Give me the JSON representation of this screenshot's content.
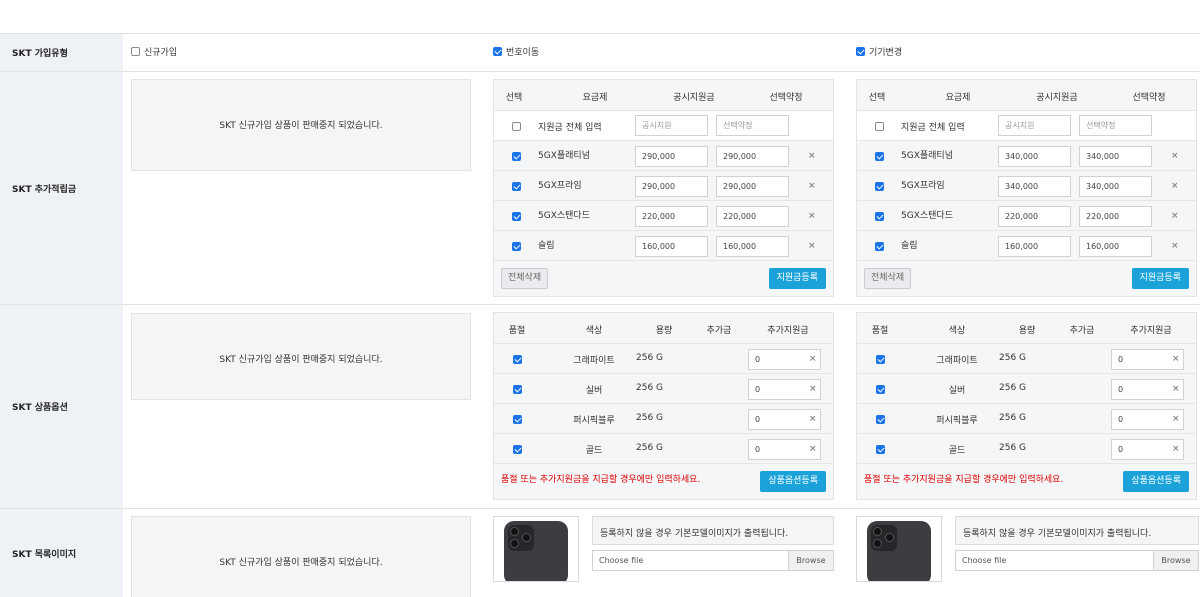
{
  "rows": {
    "type_label": "SKT 가입유형",
    "support_label": "SKT 추가적립금",
    "option_label": "SKT 상품옵션",
    "image_label": "SKT 목록이미지"
  },
  "join_types": [
    {
      "label": "신규가입",
      "checked": false
    },
    {
      "label": "번호이동",
      "checked": true
    },
    {
      "label": "기기변경",
      "checked": true
    }
  ],
  "notice_text": "SKT 신규가입 상품이 판매중지 되었습니다.",
  "support_headers": [
    "선택",
    "요금제",
    "공시지원금",
    "선택약정"
  ],
  "bulk": {
    "label": "지원금 전체 입력",
    "ph1": "공시지원",
    "ph2": "선택약정"
  },
  "support_panels": [
    {
      "plans": [
        {
          "name": "5GX플래티넘",
          "v1": "290,000",
          "v2": "290,000"
        },
        {
          "name": "5GX프라임",
          "v1": "290,000",
          "v2": "290,000"
        },
        {
          "name": "5GX스탠다드",
          "v1": "220,000",
          "v2": "220,000"
        },
        {
          "name": "슬림",
          "v1": "160,000",
          "v2": "160,000"
        }
      ]
    },
    {
      "plans": [
        {
          "name": "5GX플래티넘",
          "v1": "340,000",
          "v2": "340,000"
        },
        {
          "name": "5GX프라임",
          "v1": "340,000",
          "v2": "340,000"
        },
        {
          "name": "5GX스탠다드",
          "v1": "220,000",
          "v2": "220,000"
        },
        {
          "name": "슬림",
          "v1": "160,000",
          "v2": "160,000"
        }
      ]
    }
  ],
  "buttons": {
    "delete_all": "전체삭제",
    "register_support": "지원금등록",
    "register_option": "상품옵션등록",
    "browse": "Browse",
    "choose_file": "Choose file"
  },
  "option_headers": [
    "품절",
    "색상",
    "용량",
    "추가금",
    "추가지원금"
  ],
  "options": [
    {
      "color": "그래파이트",
      "capacity": "256 G",
      "extra": "0"
    },
    {
      "color": "실버",
      "capacity": "256 G",
      "extra": "0"
    },
    {
      "color": "퍼시픽블루",
      "capacity": "256 G",
      "extra": "0"
    },
    {
      "color": "골드",
      "capacity": "256 G",
      "extra": "0"
    }
  ],
  "option_warning": "품절 또는 추가지원금을 지급할 경우에만 입력하세요.",
  "image_note": "등록하지 않을 경우 기본모델이미지가 출력됩니다.",
  "icons": {
    "remove": "×",
    "check": "checkbox-icon",
    "phone": "phone-thumbnail"
  },
  "colors": {
    "accent_blue": "#1ba3d9",
    "checkbox_blue": "#1a73e8",
    "warning_red": "#dd0000",
    "label_bg": "#eef2f7"
  }
}
